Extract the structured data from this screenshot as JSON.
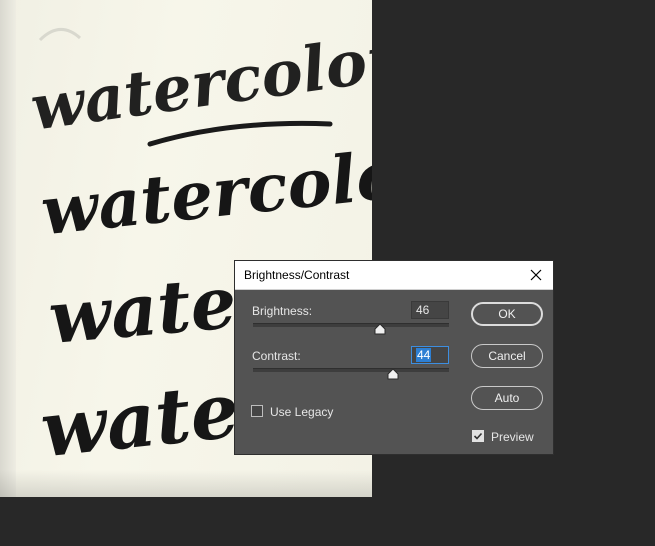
{
  "dialog": {
    "title": "Brightness/Contrast",
    "brightness": {
      "label": "Brightness:",
      "value": "46"
    },
    "contrast": {
      "label": "Contrast:",
      "value": "44"
    },
    "use_legacy": {
      "label": "Use Legacy",
      "checked": false
    },
    "preview": {
      "label": "Preview",
      "checked": true
    },
    "buttons": {
      "ok": "OK",
      "cancel": "Cancel",
      "auto": "Auto"
    }
  },
  "icons": {
    "close": "close-icon",
    "check": "checkmark-icon"
  },
  "colors": {
    "dialog_bg": "#535353",
    "workspace_bg": "#282828",
    "focus": "#2d7fd3"
  }
}
